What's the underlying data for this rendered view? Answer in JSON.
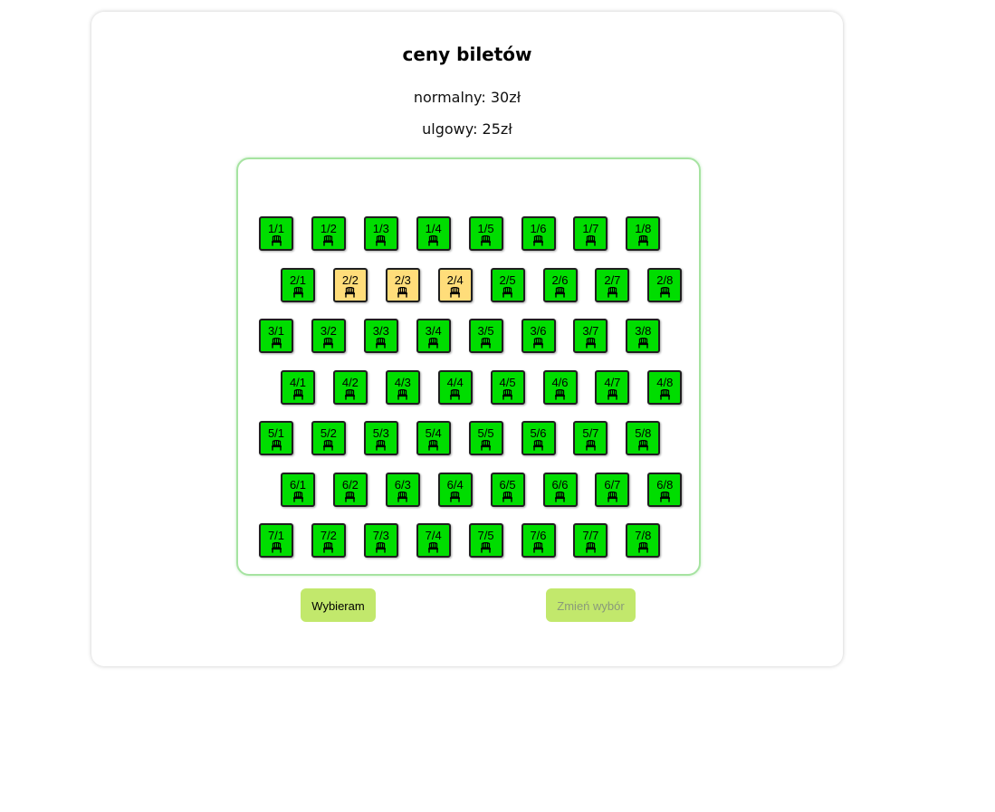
{
  "header": {
    "title": "ceny biletów",
    "normal_price": "normalny: 30zł",
    "reduced_price": "ulgowy: 25zł"
  },
  "colors": {
    "free_seat": "#00dd00",
    "taken_seat": "#ffdd7a",
    "button": "#c2e86c",
    "hall_border": "#a6e3a1"
  },
  "seat_icon": "chair-icon",
  "rows": [
    {
      "row": 1,
      "seats": [
        {
          "label": "1/1",
          "status": "free"
        },
        {
          "label": "1/2",
          "status": "free"
        },
        {
          "label": "1/3",
          "status": "free"
        },
        {
          "label": "1/4",
          "status": "free"
        },
        {
          "label": "1/5",
          "status": "free"
        },
        {
          "label": "1/6",
          "status": "free"
        },
        {
          "label": "1/7",
          "status": "free"
        },
        {
          "label": "1/8",
          "status": "free"
        }
      ]
    },
    {
      "row": 2,
      "seats": [
        {
          "label": "2/1",
          "status": "free"
        },
        {
          "label": "2/2",
          "status": "taken"
        },
        {
          "label": "2/3",
          "status": "taken"
        },
        {
          "label": "2/4",
          "status": "taken"
        },
        {
          "label": "2/5",
          "status": "free"
        },
        {
          "label": "2/6",
          "status": "free"
        },
        {
          "label": "2/7",
          "status": "free"
        },
        {
          "label": "2/8",
          "status": "free"
        }
      ]
    },
    {
      "row": 3,
      "seats": [
        {
          "label": "3/1",
          "status": "free"
        },
        {
          "label": "3/2",
          "status": "free"
        },
        {
          "label": "3/3",
          "status": "free"
        },
        {
          "label": "3/4",
          "status": "free"
        },
        {
          "label": "3/5",
          "status": "free"
        },
        {
          "label": "3/6",
          "status": "free"
        },
        {
          "label": "3/7",
          "status": "free"
        },
        {
          "label": "3/8",
          "status": "free"
        }
      ]
    },
    {
      "row": 4,
      "seats": [
        {
          "label": "4/1",
          "status": "free"
        },
        {
          "label": "4/2",
          "status": "free"
        },
        {
          "label": "4/3",
          "status": "free"
        },
        {
          "label": "4/4",
          "status": "free"
        },
        {
          "label": "4/5",
          "status": "free"
        },
        {
          "label": "4/6",
          "status": "free"
        },
        {
          "label": "4/7",
          "status": "free"
        },
        {
          "label": "4/8",
          "status": "free"
        }
      ]
    },
    {
      "row": 5,
      "seats": [
        {
          "label": "5/1",
          "status": "free"
        },
        {
          "label": "5/2",
          "status": "free"
        },
        {
          "label": "5/3",
          "status": "free"
        },
        {
          "label": "5/4",
          "status": "free"
        },
        {
          "label": "5/5",
          "status": "free"
        },
        {
          "label": "5/6",
          "status": "free"
        },
        {
          "label": "5/7",
          "status": "free"
        },
        {
          "label": "5/8",
          "status": "free"
        }
      ]
    },
    {
      "row": 6,
      "seats": [
        {
          "label": "6/1",
          "status": "free"
        },
        {
          "label": "6/2",
          "status": "free"
        },
        {
          "label": "6/3",
          "status": "free"
        },
        {
          "label": "6/4",
          "status": "free"
        },
        {
          "label": "6/5",
          "status": "free"
        },
        {
          "label": "6/6",
          "status": "free"
        },
        {
          "label": "6/7",
          "status": "free"
        },
        {
          "label": "6/8",
          "status": "free"
        }
      ]
    },
    {
      "row": 7,
      "seats": [
        {
          "label": "7/1",
          "status": "free"
        },
        {
          "label": "7/2",
          "status": "free"
        },
        {
          "label": "7/3",
          "status": "free"
        },
        {
          "label": "7/4",
          "status": "free"
        },
        {
          "label": "7/5",
          "status": "free"
        },
        {
          "label": "7/6",
          "status": "free"
        },
        {
          "label": "7/7",
          "status": "free"
        },
        {
          "label": "7/8",
          "status": "free"
        }
      ]
    }
  ],
  "buttons": {
    "choose_label": "Wybieram",
    "change_label": "Zmień wybór",
    "change_enabled": false
  }
}
